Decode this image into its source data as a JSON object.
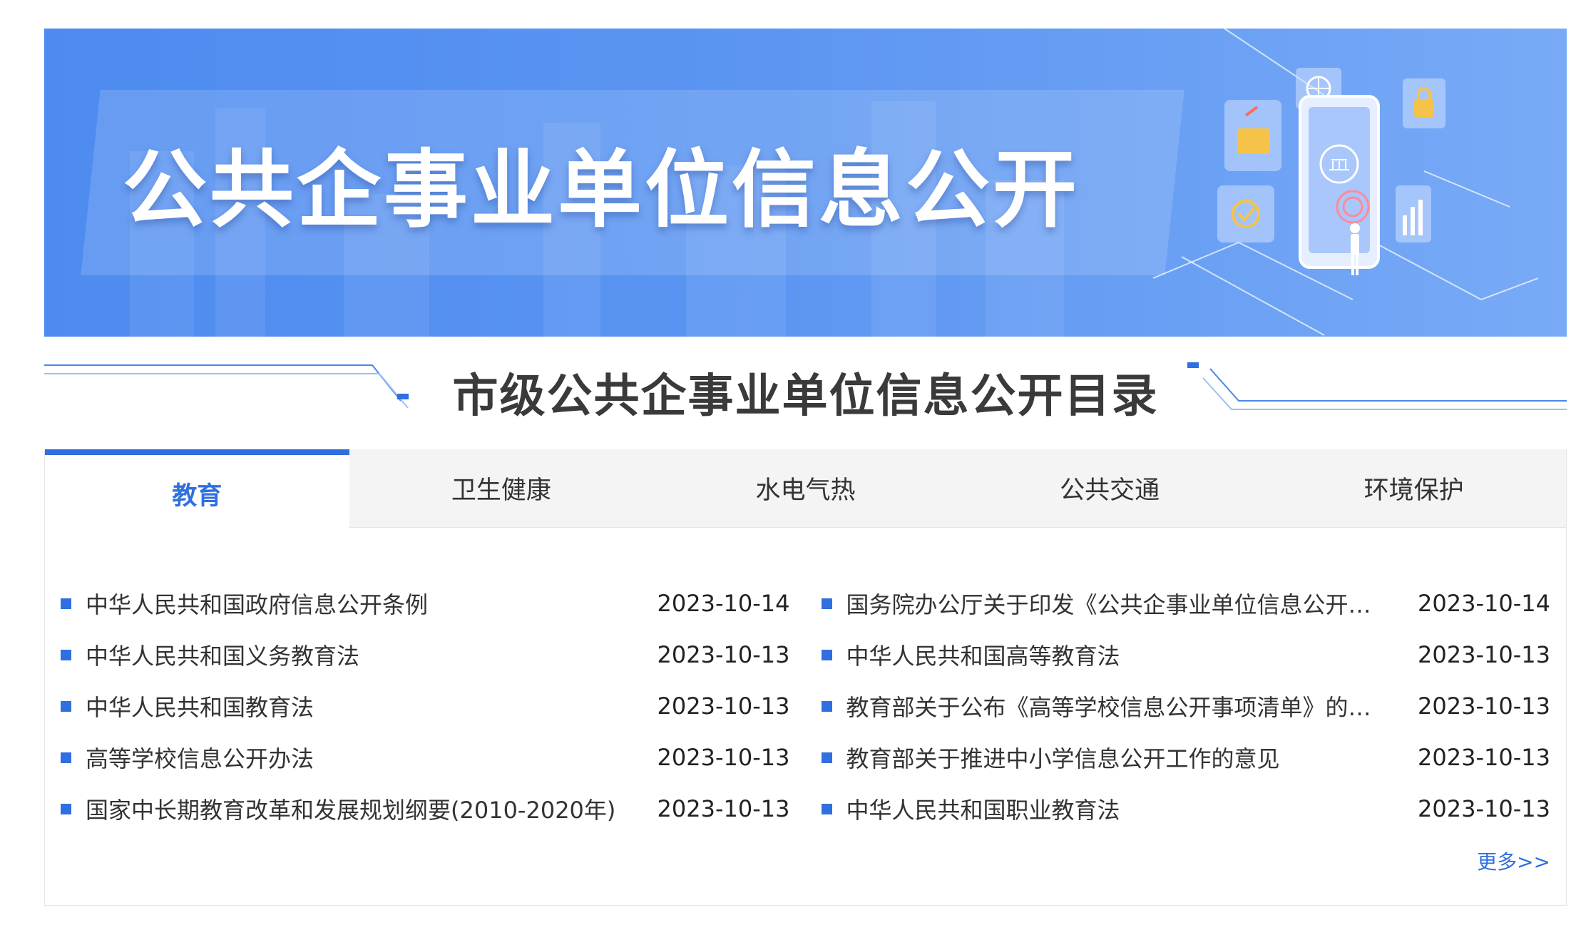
{
  "banner": {
    "title": "公共企事业单位信息公开"
  },
  "section": {
    "title": "市级公共企事业单位信息公开目录"
  },
  "tabs": [
    {
      "label": "教育",
      "active": true
    },
    {
      "label": "卫生健康",
      "active": false
    },
    {
      "label": "水电气热",
      "active": false
    },
    {
      "label": "公共交通",
      "active": false
    },
    {
      "label": "环境保护",
      "active": false
    }
  ],
  "left_items": [
    {
      "title": "中华人民共和国政府信息公开条例",
      "date": "2023-10-14"
    },
    {
      "title": "中华人民共和国义务教育法",
      "date": "2023-10-13"
    },
    {
      "title": "中华人民共和国教育法",
      "date": "2023-10-13"
    },
    {
      "title": "高等学校信息公开办法",
      "date": "2023-10-13"
    },
    {
      "title": "国家中长期教育改革和发展规划纲要(2010-2020年)",
      "date": "2023-10-13"
    }
  ],
  "right_items": [
    {
      "title": "国务院办公厅关于印发《公共企事业单位信息公开…",
      "date": "2023-10-14"
    },
    {
      "title": "中华人民共和国高等教育法",
      "date": "2023-10-13"
    },
    {
      "title": "教育部关于公布《高等学校信息公开事项清单》的…",
      "date": "2023-10-13"
    },
    {
      "title": "教育部关于推进中小学信息公开工作的意见",
      "date": "2023-10-13"
    },
    {
      "title": "中华人民共和国职业教育法",
      "date": "2023-10-13"
    }
  ],
  "more_label": "更多>>",
  "colors": {
    "accent": "#2f6fe0",
    "banner": "#5b95f2"
  }
}
